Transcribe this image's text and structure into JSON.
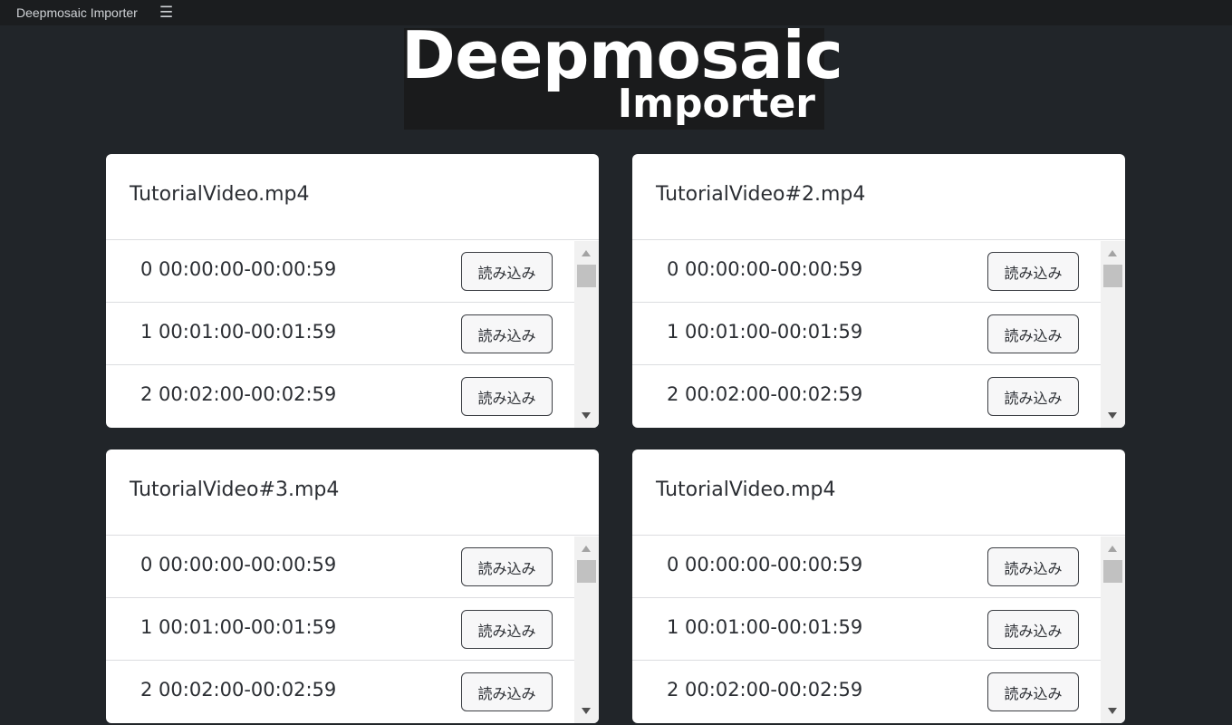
{
  "app": {
    "title": "Deepmosaic Importer",
    "menu_icon": "hamburger-icon",
    "colors": {
      "background": "#212529",
      "topbar": "#1b1d1f",
      "card": "#ffffff",
      "border": "#dcdde0"
    }
  },
  "logo": {
    "line1": "Deepmosaic",
    "line2": "Importer"
  },
  "cards": [
    {
      "title": "TutorialVideo.mp4",
      "segments": [
        {
          "label": "0 00:00:00-00:00:59",
          "button": "読み込み"
        },
        {
          "label": "1 00:01:00-00:01:59",
          "button": "読み込み"
        },
        {
          "label": "2 00:02:00-00:02:59",
          "button": "読み込み"
        }
      ]
    },
    {
      "title": "TutorialVideo#2.mp4",
      "segments": [
        {
          "label": "0 00:00:00-00:00:59",
          "button": "読み込み"
        },
        {
          "label": "1 00:01:00-00:01:59",
          "button": "読み込み"
        },
        {
          "label": "2 00:02:00-00:02:59",
          "button": "読み込み"
        }
      ]
    },
    {
      "title": "TutorialVideo#3.mp4",
      "segments": [
        {
          "label": "0 00:00:00-00:00:59",
          "button": "読み込み"
        },
        {
          "label": "1 00:01:00-00:01:59",
          "button": "読み込み"
        },
        {
          "label": "2 00:02:00-00:02:59",
          "button": "読み込み"
        }
      ]
    },
    {
      "title": "TutorialVideo.mp4",
      "segments": [
        {
          "label": "0 00:00:00-00:00:59",
          "button": "読み込み"
        },
        {
          "label": "1 00:01:00-00:01:59",
          "button": "読み込み"
        },
        {
          "label": "2 00:02:00-00:02:59",
          "button": "読み込み"
        }
      ]
    }
  ]
}
